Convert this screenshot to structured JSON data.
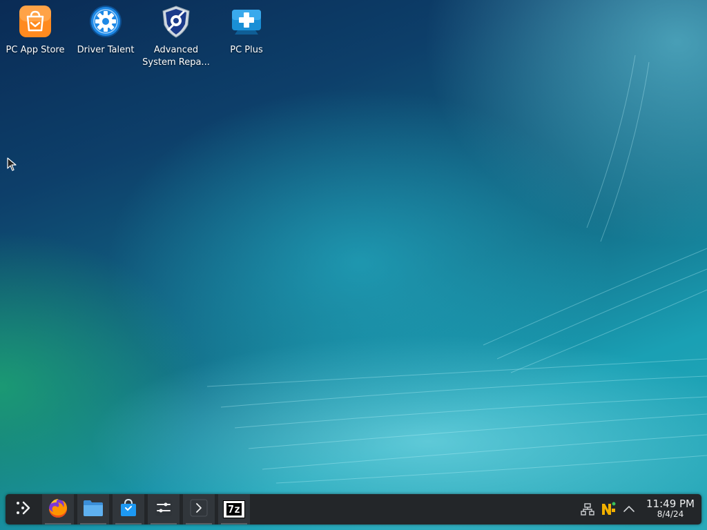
{
  "desktop": {
    "icons": [
      {
        "label": "PC App Store",
        "icon": "shopping-bag-icon"
      },
      {
        "label": "Driver Talent",
        "icon": "gear-icon"
      },
      {
        "label": "Advanced System Repa...",
        "icon": "shield-wrench-icon"
      },
      {
        "label": "PC Plus",
        "icon": "medical-cross-icon"
      }
    ]
  },
  "taskbar": {
    "start_icon": "app-launcher-icon",
    "apps": [
      {
        "name": "Firefox",
        "icon": "firefox-icon"
      },
      {
        "name": "File Manager",
        "icon": "folder-icon"
      },
      {
        "name": "Discover",
        "icon": "store-bag-icon"
      },
      {
        "name": "System Settings",
        "icon": "settings-sliders-icon"
      },
      {
        "name": "Terminal",
        "icon": "terminal-icon"
      },
      {
        "name": "7-Zip",
        "icon": "seven-zip-icon",
        "text": "7z"
      }
    ],
    "tray": {
      "icons": [
        "network-icon",
        "notes-icon",
        "chevron-up-icon"
      ],
      "clock": {
        "time": "11:49 PM",
        "date": "8/4/24"
      }
    }
  },
  "colors": {
    "taskbar_bg": "#232629",
    "taskbar_active": "#31363b",
    "text": "#ffffff",
    "app_store_orange": "#ff8a1f",
    "driver_talent_blue": "#1e88e5",
    "pc_plus_blue": "#1a8fd6"
  }
}
